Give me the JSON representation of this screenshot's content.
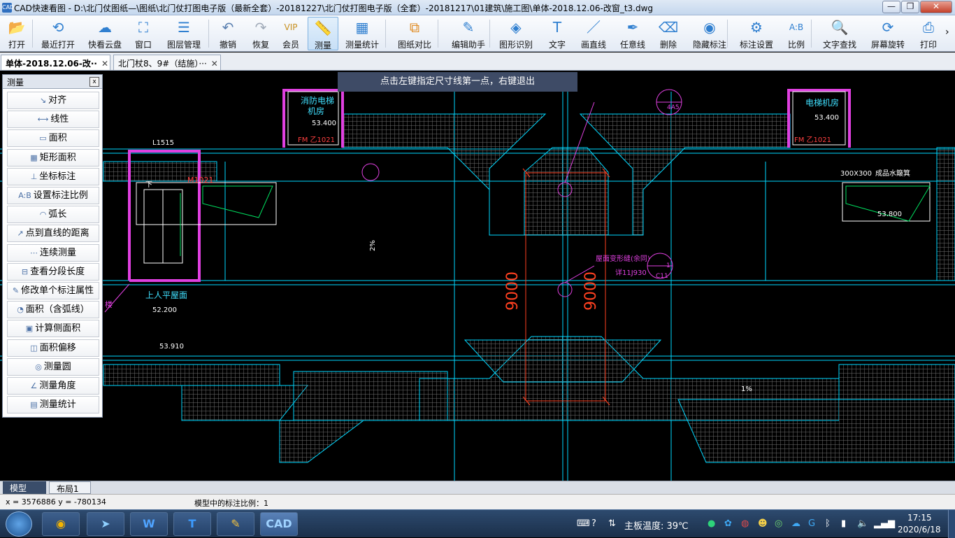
{
  "window": {
    "title": "CAD快速看图 - D:\\北门仗图纸—\\图纸\\北门仗打图电子版（最新全套）-20181227\\北门仗打图电子版（全套）-20181217\\01建筑\\施工图\\单体-2018.12.06-改窗_t3.dwg",
    "icon_label": "CAD",
    "minimize": "—",
    "restore": "❐",
    "close": "✕"
  },
  "toolbar": [
    {
      "label": "打开",
      "icon": "folder-icon",
      "glyph": "📂"
    },
    {
      "label": "最近打开",
      "icon": "history-icon",
      "glyph": "⟲"
    },
    {
      "label": "快看云盘",
      "icon": "cloud-icon",
      "glyph": "☁"
    },
    {
      "label": "窗口",
      "icon": "window-icon",
      "glyph": "⛶"
    },
    {
      "label": "图层管理",
      "icon": "layers-icon",
      "glyph": "☰"
    },
    {
      "label": "撤销",
      "icon": "undo-icon",
      "glyph": "↶"
    },
    {
      "label": "恢复",
      "icon": "redo-icon",
      "glyph": "↷"
    },
    {
      "label": "会员",
      "icon": "vip-icon",
      "glyph": "VIP"
    },
    {
      "label": "测量",
      "icon": "ruler-icon",
      "glyph": "📏"
    },
    {
      "label": "测量统计",
      "icon": "measure-stats-icon",
      "glyph": "▦"
    },
    {
      "label": "图纸对比",
      "icon": "compare-icon",
      "glyph": "⧉"
    },
    {
      "label": "编辑助手",
      "icon": "edit-assistant-icon",
      "glyph": "✎"
    },
    {
      "label": "图形识别",
      "icon": "shape-recognition-icon",
      "glyph": "◈"
    },
    {
      "label": "文字",
      "icon": "text-icon",
      "glyph": "T"
    },
    {
      "label": "画直线",
      "icon": "line-icon",
      "glyph": "／"
    },
    {
      "label": "任意线",
      "icon": "pen-icon",
      "glyph": "✒"
    },
    {
      "label": "删除",
      "icon": "eraser-icon",
      "glyph": "⌫"
    },
    {
      "label": "隐藏标注",
      "icon": "hide-eye-icon",
      "glyph": "◉"
    },
    {
      "label": "标注设置",
      "icon": "annotation-settings-icon",
      "glyph": "⚙"
    },
    {
      "label": "比例",
      "icon": "scale-icon",
      "glyph": "A:B"
    },
    {
      "label": "文字查找",
      "icon": "text-search-icon",
      "glyph": "🔍"
    },
    {
      "label": "屏幕旋转",
      "icon": "rotate-screen-icon",
      "glyph": "⟳"
    },
    {
      "label": "打印",
      "icon": "printer-icon",
      "glyph": "⎙"
    }
  ],
  "tabs": [
    {
      "label": "单体-2018.12.06-改··",
      "close": "✕"
    },
    {
      "label": "北门杖8、9#（结施）···",
      "close": "✕"
    }
  ],
  "hint": "点击左键指定尺寸线第一点，右键退出",
  "measure_panel": {
    "title": "测量",
    "close": "x",
    "items": [
      {
        "label": "对齐",
        "icon": "align-measure-icon"
      },
      {
        "label": "线性",
        "icon": "linear-measure-icon"
      },
      {
        "label": "面积",
        "icon": "area-icon"
      },
      {
        "label": "矩形面积",
        "icon": "rect-area-icon"
      },
      {
        "label": "坐标标注",
        "icon": "coordinate-icon"
      },
      {
        "label": "设置标注比例",
        "icon": "scale-setting-icon"
      },
      {
        "label": "弧长",
        "icon": "arc-length-icon"
      },
      {
        "label": "点到直线的距离",
        "icon": "point-line-icon"
      },
      {
        "label": "连续测量",
        "icon": "continuous-icon"
      },
      {
        "label": "查看分段长度",
        "icon": "segment-icon"
      },
      {
        "label": "修改单个标注属性",
        "icon": "modify-icon"
      },
      {
        "label": "面积（含弧线）",
        "icon": "arc-area-icon"
      },
      {
        "label": "计算侧面积",
        "icon": "side-area-icon"
      },
      {
        "label": "面积偏移",
        "icon": "area-offset-icon"
      },
      {
        "label": "测量圆",
        "icon": "circle-measure-icon"
      },
      {
        "label": "测量角度",
        "icon": "angle-icon"
      },
      {
        "label": "测量统计",
        "icon": "stats-icon"
      }
    ]
  },
  "drawing": {
    "labels": [
      {
        "text": "消防电梯",
        "color": "#40e0ff"
      },
      {
        "text": "机房",
        "color": "#40e0ff"
      },
      {
        "text": "53.400",
        "color": "#ffffff"
      },
      {
        "text": "FM 乙1021",
        "color": "#ff4040"
      },
      {
        "text": "电梯机房",
        "color": "#40e0ff"
      },
      {
        "text": "53.400",
        "color": "#ffffff"
      },
      {
        "text": "FM 乙1021",
        "color": "#ff4040"
      },
      {
        "text": "L1515",
        "color": "#ffffff"
      },
      {
        "text": "M1021",
        "color": "#ff4040"
      },
      {
        "text": "下",
        "color": "#ffffff"
      },
      {
        "text": "上人平屋面",
        "color": "#40e0ff"
      },
      {
        "text": "52.200",
        "color": "#ffffff"
      },
      {
        "text": "53.910",
        "color": "#ffffff"
      },
      {
        "text": "300X300",
        "color": "#ffffff"
      },
      {
        "text": "成品水簸箕",
        "color": "#ffffff"
      },
      {
        "text": "53.800",
        "color": "#ffffff"
      },
      {
        "text": "屋面变形缝(余同)",
        "color": "#e040e0"
      },
      {
        "text": "详11J930",
        "color": "#e040e0"
      },
      {
        "text": "1",
        "color": "#e040e0"
      },
      {
        "text": "C11",
        "color": "#e040e0"
      },
      {
        "text": "4A5",
        "color": "#e040e0"
      },
      {
        "text": "9000",
        "color": "#ff4020"
      },
      {
        "text": "9000",
        "color": "#ff4020"
      },
      {
        "text": "1%",
        "color": "#ffffff"
      },
      {
        "text": "2%",
        "color": "#ffffff"
      },
      {
        "text": "楼",
        "color": "#e040e0"
      }
    ]
  },
  "layout_tabs": [
    "模型",
    "布局1"
  ],
  "status": {
    "coords": "x = 3576886  y = -780134",
    "scale": "模型中的标注比例：1"
  },
  "taskbar": {
    "temperature": "主板温度: 39℃",
    "time": "17:15",
    "date": "2020/6/18"
  }
}
